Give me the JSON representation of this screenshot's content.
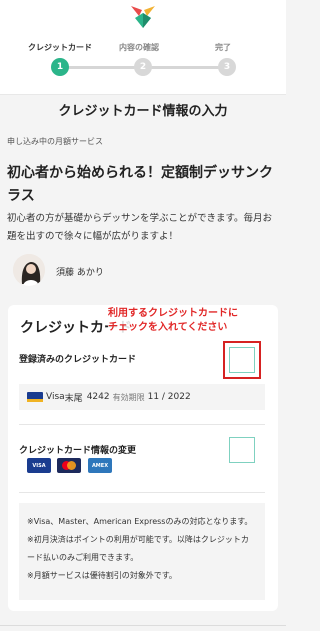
{
  "steps": [
    {
      "label": "クレジットカード",
      "number": "1",
      "active": true
    },
    {
      "label": "内容の確認",
      "number": "2",
      "active": false
    },
    {
      "label": "完了",
      "number": "3",
      "active": false
    }
  ],
  "page_title": "クレジットカード情報の入力",
  "section_label": "申し込み中の月額サービス",
  "service": {
    "title": "初心者から始められる！定額制デッサンクラス",
    "description": "初心者の方が基礎からデッサンを学ぶことができます。毎月お題を出すので徐々に幅が広がりますよ！"
  },
  "teacher": {
    "name": "須藤 あかり"
  },
  "card_section": {
    "title": "クレジットカード",
    "annotation_line1": "利用するクレジットカードに",
    "annotation_line2": "チェックを入れてください",
    "registered_label": "登録済みのクレジットカード",
    "registered_card": {
      "brand": "Visa",
      "last4_label": "末尾",
      "last4": "4242",
      "expiry_label": "有効期限",
      "expiry": "11 / 2022"
    },
    "change_label": "クレジットカード情報の変更",
    "brands": [
      "VISA",
      "MC",
      "AMEX"
    ],
    "notes": [
      "※Visa、Master、American Expressのみの対応となります。",
      "※初月決済はポイントの利用が可能です。以降はクレジットカード払いのみご利用できます。",
      "※月額サービスは優待割引の対象外です。"
    ]
  },
  "colors": {
    "accent": "#2bb58a",
    "annotation": "#e12727",
    "checkbox_border": "#7fd1c0"
  }
}
